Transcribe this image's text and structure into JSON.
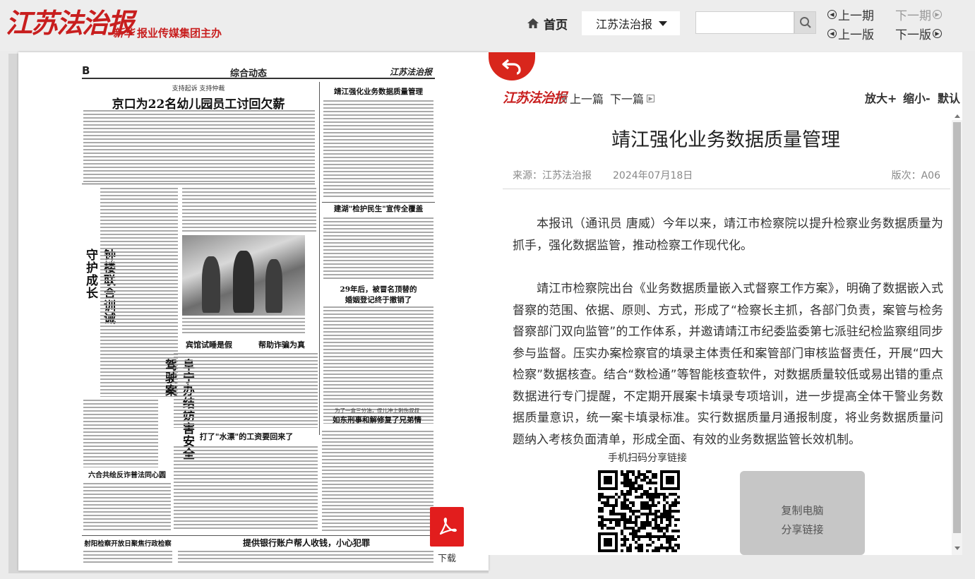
{
  "header": {
    "logo": "江苏法治报",
    "logo_sub_mark": "新华",
    "logo_sub": "报业传媒集团主办",
    "home_label": "首页",
    "paper_select_value": "江苏法治报",
    "search_placeholder": "",
    "nav": {
      "prev_date": "上一期",
      "next_date": "下一期",
      "prev_edition": "上一版",
      "next_edition": "下一版"
    }
  },
  "newspaper": {
    "page_letter": "B",
    "section_title": "综合动态",
    "brand": "江苏法治报",
    "kicker_1": "支持起诉  支持仲裁",
    "headline_1": "京口为22名幼儿园员工讨回欠薪",
    "headline_2": "靖江强化业务数据质量管理",
    "headline_3": "建湖\"检护民生\"宣传全覆盖",
    "headline_4a": "29年后，被冒名顶替的",
    "headline_4b": "婚姻登记终于撤销了",
    "vertical_1": "钟楼联合训诫守护成长",
    "vertical_2": "阜宁办结妨害安全驾驶案",
    "headline_5": "宾馆试睡是假",
    "headline_6": "帮助诈骗为真",
    "headline_7": "打了\"水漂\"的工资要回来了",
    "headline_8": "六合共绘反诈普法同心圆",
    "kicker_9": "为了一盒三分油，侄儿冲上刺伤叔叔",
    "headline_9": "如东刑事和解修复了兄弟情",
    "headline_10": "射阳检察开放日聚焦行政检察",
    "headline_11": "提供银行账户帮人收钱，小心犯罪"
  },
  "pdf": {
    "label": "下载"
  },
  "reader": {
    "brand": "江苏法治报",
    "prev_article": "上一篇",
    "next_article": "下一篇",
    "zoom_in": "放大+",
    "zoom_out": "缩小-",
    "reset": "默认",
    "title": "靖江强化业务数据质量管理",
    "source": "来源：江苏法治报",
    "date": "2024年07月18日",
    "edition": "版次：A06",
    "paragraphs": [
      "本报讯（通讯员 唐威）今年以来，靖江市检察院以提升检察业务数据质量为抓手，强化数据监管，推动检察工作现代化。",
      "靖江市检察院出台《业务数据质量嵌入式督察工作方案》，明确了数据嵌入式督察的范围、依据、原则、方式，形成了“检察长主抓，各部门负责，案管与检务督察部门双向监管”的工作体系，并邀请靖江市纪委监委第七派驻纪检监察组同步参与监督。压实办案检察官的填录主体责任和案管部门审核监督责任，开展“四大检察”数据核查。结合“数检通”等智能核查软件，对数据质量较低或易出错的重点数据进行专门提醒，不定期开展案卡填录专项培训，进一步提高全体干警业务数据质量意识，统一案卡填录标准。实行数据质量月通报制度，将业务数据质量问题纳入考核负面清单，形成全面、有效的业务数据监管长效机制。"
    ],
    "share_label": "手机扫码分享链接",
    "copy_line1": "复制电脑",
    "copy_line2": "分享链接"
  },
  "colors": {
    "brand_red": "#c81e1e",
    "back_button": "#d8261c",
    "pdf_red": "#e21d1d",
    "copy_button": "#c6c6c6"
  },
  "icons": {
    "home": "home-icon",
    "search": "search-icon",
    "back": "back-arrow-icon",
    "pdf": "pdf-icon",
    "qr": "qr-code"
  }
}
